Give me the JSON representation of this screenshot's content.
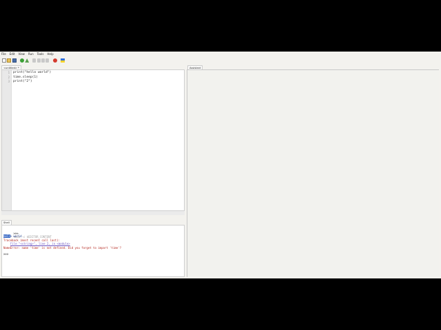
{
  "menu": [
    "File",
    "Edit",
    "View",
    "Run",
    "Tools",
    "Help"
  ],
  "toolbar_icons": [
    "new-file-icon",
    "open-file-icon",
    "save-icon",
    "run-icon",
    "debug-icon",
    "step-over-icon",
    "step-into-icon",
    "step-out-icon",
    "resume-icon",
    "stop-icon",
    "flag-icon"
  ],
  "editor": {
    "tab_label": "<untitled> *",
    "line_numbers": [
      "1",
      "2",
      "3"
    ],
    "lines": [
      "print(\"hello world\")",
      "time.sleep(1)",
      "print(\"2\")"
    ]
  },
  "shell": {
    "tab_label": "Shell",
    "prompt": ">>>",
    "command": "%Run -c $EDITOR_CONTENT",
    "output_highlight": "hell",
    "output_rest": "o world",
    "traceback_header": "Traceback (most recent call last):",
    "traceback_file": "File \"<string>\", line 2, in <module>",
    "error_message": "NameError: name 'time' is not defined. Did you forget to import 'time'?",
    "prompt2": ">>>"
  },
  "assistant": {
    "tab_label": "Assistant"
  },
  "colors": {
    "background": "#000000",
    "app_background": "#f3f2ee",
    "error": "#b3241b",
    "output": "#1e3a8a",
    "selection": "#3c6bc5"
  }
}
